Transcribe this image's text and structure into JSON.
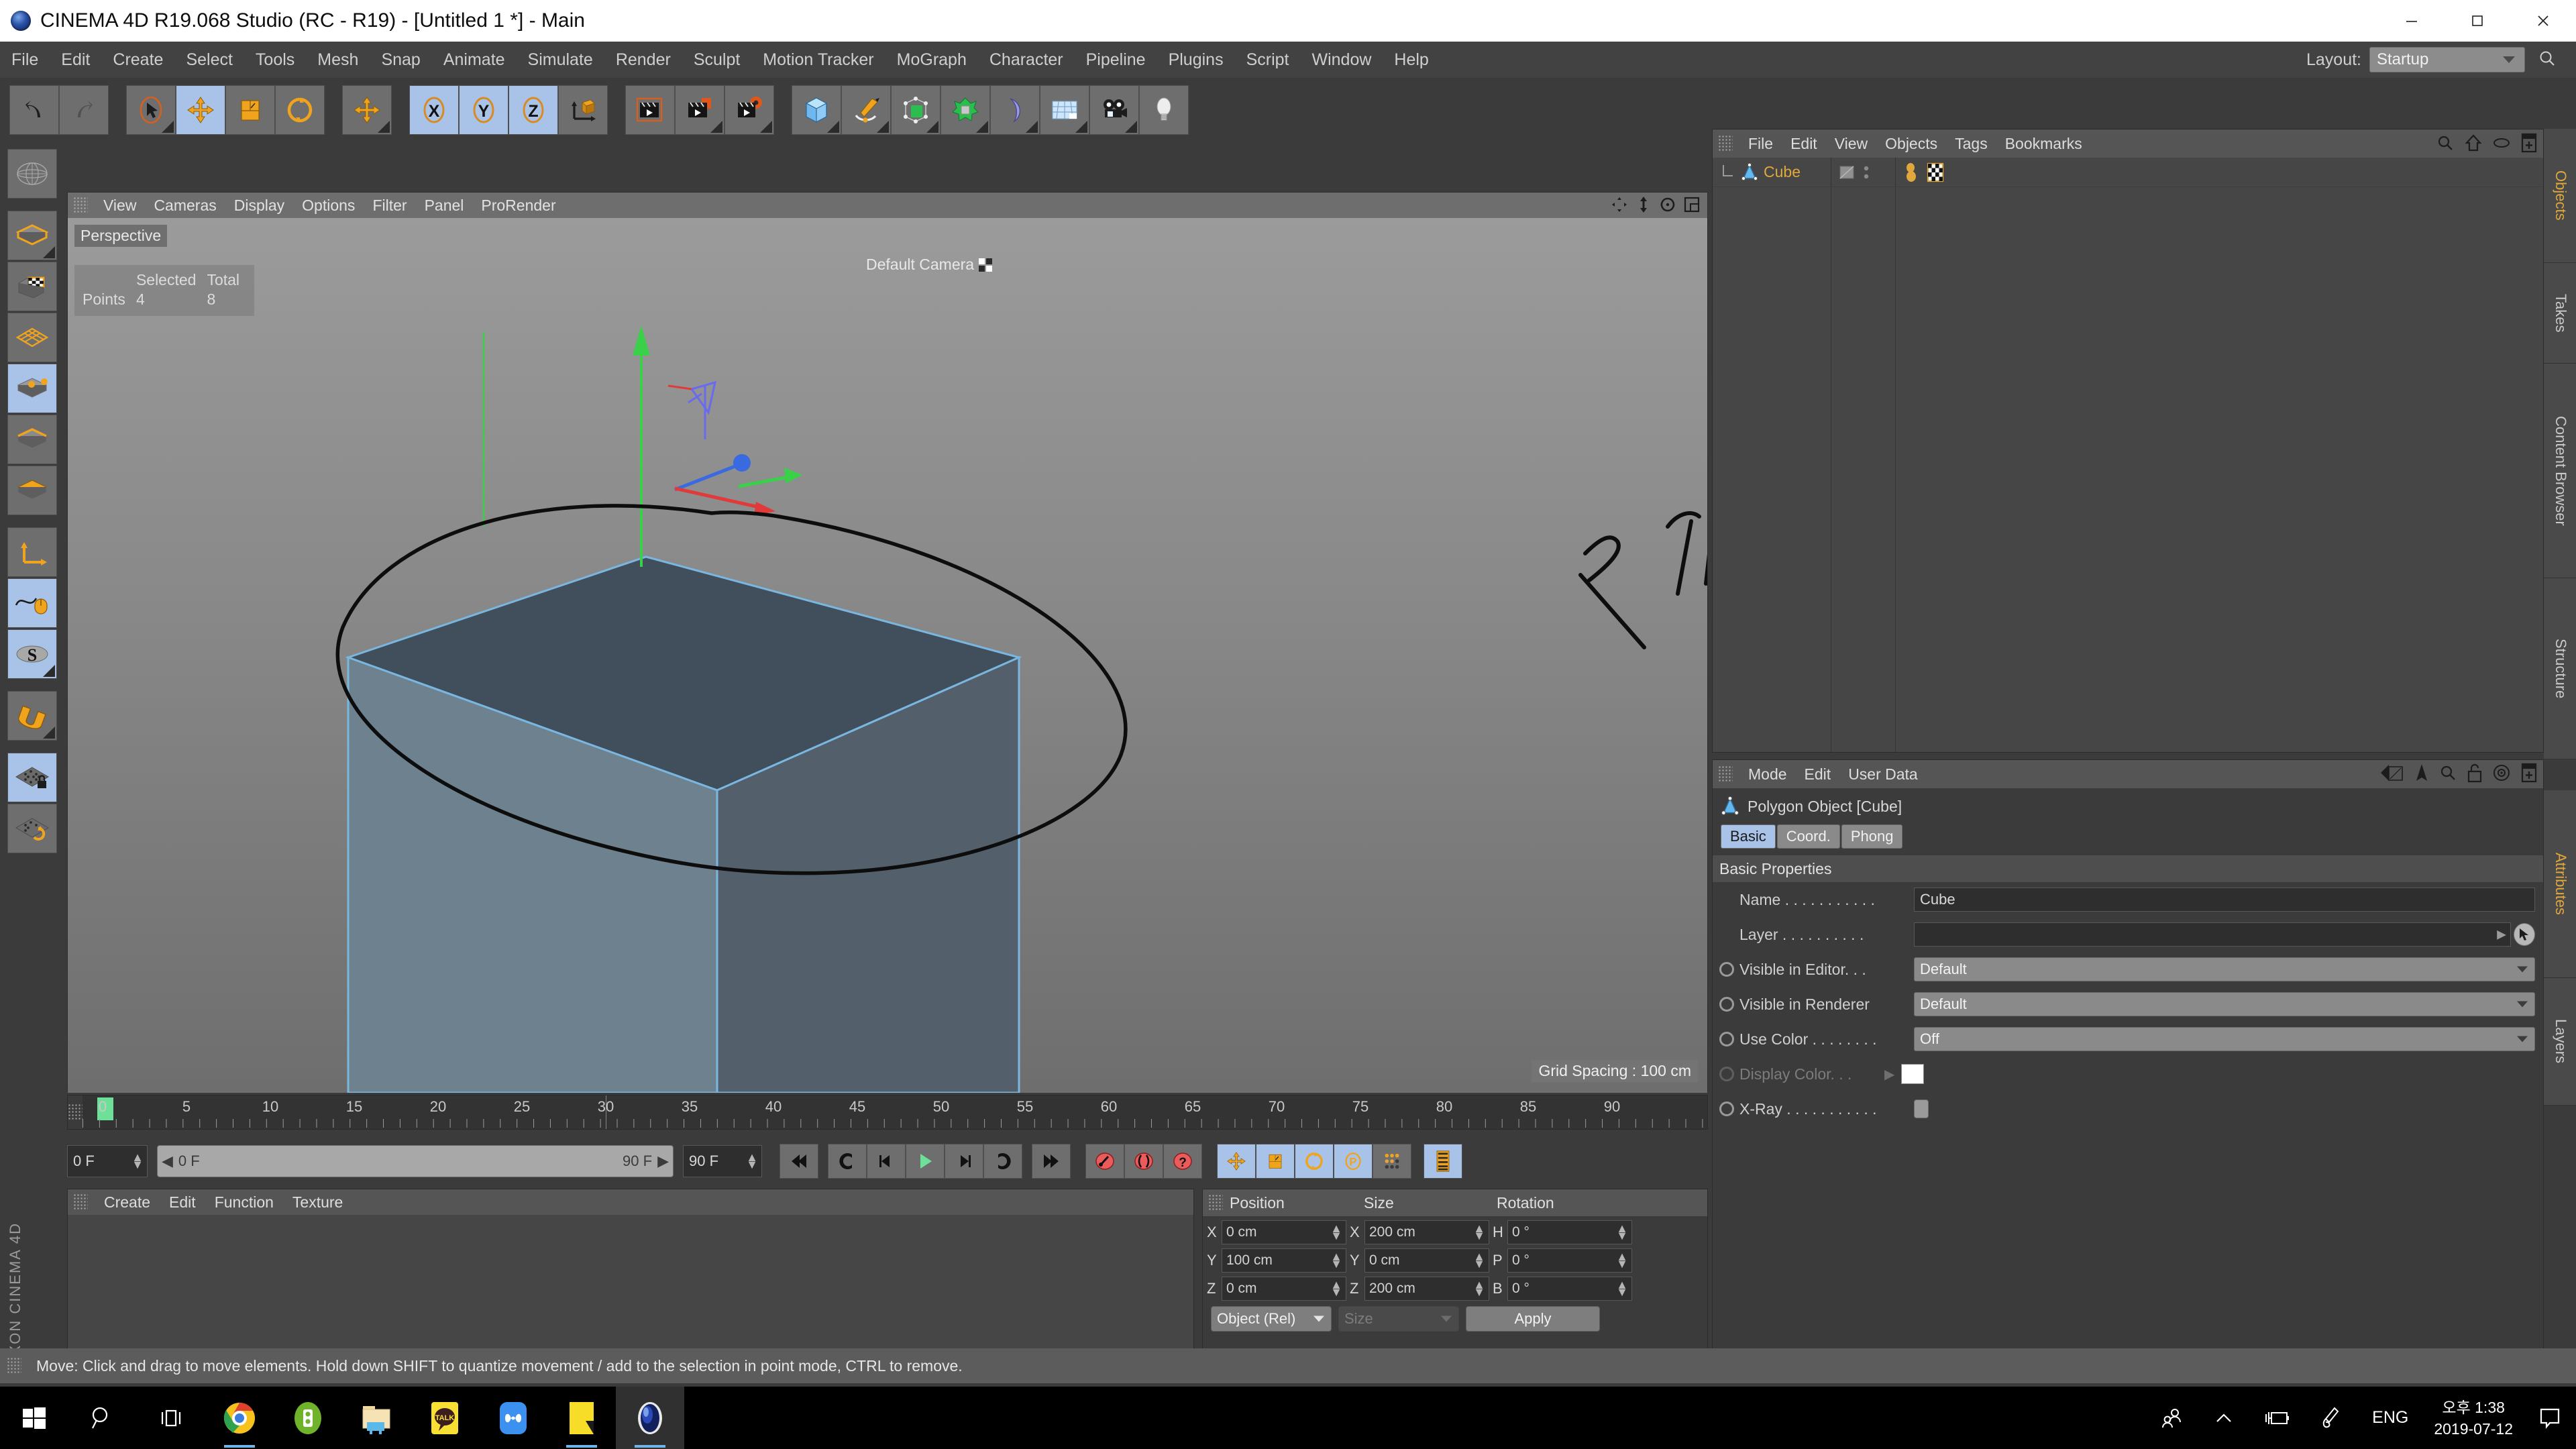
{
  "window": {
    "title": "CINEMA 4D R19.068 Studio (RC - R19) - [Untitled 1 *] - Main",
    "minimize_label": "Minimize",
    "maximize_label": "Maximize",
    "close_label": "Close"
  },
  "menubar": {
    "items": [
      "File",
      "Edit",
      "Create",
      "Select",
      "Tools",
      "Mesh",
      "Snap",
      "Animate",
      "Simulate",
      "Render",
      "Sculpt",
      "Motion Tracker",
      "MoGraph",
      "Character",
      "Pipeline",
      "Plugins",
      "Script",
      "Window",
      "Help"
    ],
    "layout_label": "Layout:",
    "layout_value": "Startup",
    "search_icon": "search-icon"
  },
  "toolbar": {
    "buttons": [
      {
        "name": "undo",
        "icon": "undo-arrow-icon",
        "selected": false
      },
      {
        "name": "redo",
        "icon": "redo-arrow-icon",
        "selected": false
      },
      {
        "name": "live-selection",
        "icon": "cursor-oval-icon",
        "selected": false
      },
      {
        "name": "move",
        "icon": "move-cross-icon",
        "selected": true
      },
      {
        "name": "scale",
        "icon": "scale-box-icon",
        "selected": false
      },
      {
        "name": "rotate",
        "icon": "rotate-circle-icon",
        "selected": false
      },
      {
        "name": "move-dup",
        "icon": "move-cross-icon",
        "selected": false
      },
      {
        "name": "axis-x",
        "icon": "x-axis-icon",
        "selected": true
      },
      {
        "name": "axis-y",
        "icon": "y-axis-icon",
        "selected": true
      },
      {
        "name": "axis-z",
        "icon": "z-axis-icon",
        "selected": true
      },
      {
        "name": "world-object-axis",
        "icon": "world-coordinate-icon",
        "selected": false
      },
      {
        "name": "render-view",
        "icon": "clapper-frame-icon",
        "selected": false
      },
      {
        "name": "render-to-picture-viewer",
        "icon": "clapper-render-icon",
        "selected": false
      },
      {
        "name": "edit-render-settings",
        "icon": "clapper-gear-icon",
        "selected": false
      },
      {
        "name": "add-cube",
        "icon": "cube-primitive-icon",
        "selected": false
      },
      {
        "name": "add-spline",
        "icon": "pen-spline-icon",
        "selected": false
      },
      {
        "name": "add-generator",
        "icon": "generator-nurbs-icon",
        "selected": false
      },
      {
        "name": "add-deformer",
        "icon": "deformer-icon",
        "selected": false
      },
      {
        "name": "add-scene-object",
        "icon": "bend-object-icon",
        "selected": false
      },
      {
        "name": "add-floor-sky",
        "icon": "floor-grid-icon",
        "selected": false
      },
      {
        "name": "add-camera",
        "icon": "camera-icon",
        "selected": false
      },
      {
        "name": "add-light",
        "icon": "light-bulb-icon",
        "selected": false
      }
    ]
  },
  "left_toolbar": {
    "buttons": [
      {
        "name": "make-editable",
        "icon": "wireframe-sphere-icon",
        "selected": false
      },
      {
        "name": "model-mode",
        "icon": "model-cube-icon",
        "selected": false
      },
      {
        "name": "texture-mode",
        "icon": "texture-checker-icon",
        "selected": false
      },
      {
        "name": "mesh-mode",
        "icon": "mesh-grid-icon",
        "selected": false
      },
      {
        "name": "points-mode",
        "icon": "points-cube-icon",
        "selected": true
      },
      {
        "name": "edges-mode",
        "icon": "edges-cube-icon",
        "selected": false
      },
      {
        "name": "polygons-mode",
        "icon": "polygons-cube-icon",
        "selected": false
      },
      {
        "name": "object-axis",
        "icon": "axis-corner-icon",
        "selected": false
      },
      {
        "name": "enable-snap",
        "icon": "mouse-curve-icon",
        "selected": true
      },
      {
        "name": "soft-selection",
        "icon": "s-ellipse-icon",
        "selected": true
      },
      {
        "name": "magnet",
        "icon": "magnet-icon",
        "selected": false
      },
      {
        "name": "workplane-lock",
        "icon": "grid-lock-icon",
        "selected": true
      },
      {
        "name": "workplane-rotate",
        "icon": "grid-rotate-icon",
        "selected": false
      }
    ],
    "brand_line1": "MAXON",
    "brand_line2": "CINEMA 4D"
  },
  "viewport": {
    "menu_items": [
      "View",
      "Cameras",
      "Display",
      "Options",
      "Filter",
      "Panel",
      "ProRender"
    ],
    "perspective_label": "Perspective",
    "camera_label": "Default Camera",
    "grid_spacing": "Grid Spacing : 100 cm",
    "stats": {
      "col_selected": "Selected",
      "col_total": "Total",
      "row_label": "Points",
      "selected": "4",
      "total": "8"
    },
    "corner_icons": [
      "pan-icon",
      "zoom-vertical-icon",
      "rotate-icon",
      "maximize-view-icon"
    ]
  },
  "timeline": {
    "ticks": [
      "0",
      "5",
      "10",
      "15",
      "20",
      "25",
      "30",
      "35",
      "40",
      "45",
      "50",
      "55",
      "60",
      "65",
      "70",
      "75",
      "80",
      "85",
      "90"
    ],
    "current_frame_marker": "0"
  },
  "transport": {
    "current_frame": "0 F",
    "range_start": "0 F",
    "range_end": "90 F",
    "max_frame": "90 F",
    "buttons": [
      {
        "name": "go-to-start",
        "icon": "skip-start-icon",
        "selected": false
      },
      {
        "name": "play-loop-back",
        "icon": "loop-back-icon",
        "selected": false
      },
      {
        "name": "step-back",
        "icon": "step-back-icon",
        "selected": false
      },
      {
        "name": "play-forward",
        "icon": "play-icon",
        "selected": false
      },
      {
        "name": "step-forward",
        "icon": "step-forward-icon",
        "selected": false
      },
      {
        "name": "play-loop-forward",
        "icon": "loop-forward-icon",
        "selected": false
      },
      {
        "name": "go-to-end",
        "icon": "skip-end-icon",
        "selected": false
      },
      {
        "name": "record-keyframe",
        "icon": "record-key-icon",
        "selected": false
      },
      {
        "name": "autokeying",
        "icon": "autokey-icon",
        "selected": false
      },
      {
        "name": "keyframe-selection",
        "icon": "key-question-icon",
        "selected": false
      },
      {
        "name": "position-key",
        "icon": "move-cross-icon",
        "selected": true
      },
      {
        "name": "scale-key",
        "icon": "scale-box-icon",
        "selected": true
      },
      {
        "name": "rotation-key",
        "icon": "rotate-circle-icon",
        "selected": true
      },
      {
        "name": "param-key",
        "icon": "p-circle-icon",
        "selected": true
      },
      {
        "name": "point-level-anim",
        "icon": "pla-dots-icon",
        "selected": false
      },
      {
        "name": "timeline-filmstrip",
        "icon": "filmstrip-icon",
        "selected": true
      }
    ]
  },
  "material_manager": {
    "menu_items": [
      "Create",
      "Edit",
      "Function",
      "Texture"
    ]
  },
  "coordinate_manager": {
    "headers": [
      "Position",
      "Size",
      "Rotation"
    ],
    "rows": [
      {
        "pos_axis": "X",
        "pos_value": "0 cm",
        "size_axis": "X",
        "size_value": "200 cm",
        "rot_axis": "H",
        "rot_value": "0 °"
      },
      {
        "pos_axis": "Y",
        "pos_value": "100 cm",
        "size_axis": "Y",
        "size_value": "0 cm",
        "rot_axis": "P",
        "rot_value": "0 °"
      },
      {
        "pos_axis": "Z",
        "pos_value": "0 cm",
        "size_axis": "Z",
        "size_value": "200 cm",
        "rot_axis": "B",
        "rot_value": "0 °"
      }
    ],
    "mode_dropdown": "Object (Rel)",
    "size_dropdown": "Size",
    "apply_label": "Apply"
  },
  "object_manager": {
    "menu_items": [
      "File",
      "Edit",
      "View",
      "Objects",
      "Tags",
      "Bookmarks"
    ],
    "icons": [
      "search-icon",
      "home-up-icon",
      "ellipse-icon",
      "add-layer-icon"
    ],
    "objects": [
      {
        "name": "Cube",
        "icon": "polygon-object-icon",
        "tags": [
          "texture-tag-icon",
          "checker-tag-icon"
        ]
      }
    ],
    "tab_label": "Objects"
  },
  "attribute_manager": {
    "menu_items": [
      "Mode",
      "Edit",
      "User Data"
    ],
    "icons": [
      "back-arrow-icon",
      "up-arrow-icon",
      "search-icon",
      "lock-icon",
      "target-icon",
      "add-panel-icon"
    ],
    "object_title": "Polygon Object [Cube]",
    "tabs": [
      {
        "label": "Basic",
        "active": true
      },
      {
        "label": "Coord.",
        "active": false
      },
      {
        "label": "Phong",
        "active": false
      }
    ],
    "section_title": "Basic Properties",
    "properties": [
      {
        "label": "Name . . . . . . . . . . .",
        "control": "text",
        "value": "Cube",
        "radio": "none",
        "dim": false
      },
      {
        "label": "Layer  . . . . . . . . . .",
        "control": "layer",
        "value": "",
        "radio": "none",
        "dim": false
      },
      {
        "label": "Visible in Editor. . .",
        "control": "select",
        "value": "Default",
        "radio": "on",
        "dim": false
      },
      {
        "label": "Visible in Renderer",
        "control": "select",
        "value": "Default",
        "radio": "on",
        "dim": false
      },
      {
        "label": "Use Color . . . . . . . .",
        "control": "select",
        "value": "Off",
        "radio": "on",
        "dim": false
      },
      {
        "label": "Display Color. . .",
        "control": "swatch",
        "value": "",
        "radio": "dim",
        "dim": true
      },
      {
        "label": "X-Ray . . . . . . . . . . .",
        "control": "toggle",
        "value": "",
        "radio": "on",
        "dim": false
      }
    ],
    "tab_label_attributes": "Attributes",
    "tab_label_layers": "Layers"
  },
  "right_tabs": {
    "top": [
      "Objects",
      "Takes",
      "Content Browser",
      "Structure"
    ],
    "bottom": [
      "Attributes",
      "Layers"
    ]
  },
  "statusbar": {
    "text": "Move: Click and drag to move elements. Hold down SHIFT to quantize movement / add to the selection in point mode, CTRL to remove."
  },
  "taskbar": {
    "items": [
      {
        "name": "start-button",
        "icon": "windows-logo-icon"
      },
      {
        "name": "search-taskbar",
        "icon": "search-icon"
      },
      {
        "name": "task-view",
        "icon": "task-view-icon"
      },
      {
        "name": "chrome",
        "icon": "chrome-icon",
        "running": true
      },
      {
        "name": "green-app",
        "icon": "green-oval-icon",
        "running": false
      },
      {
        "name": "file-explorer",
        "icon": "folder-icon",
        "running": false
      },
      {
        "name": "kakaotalk",
        "icon": "talk-icon",
        "running": false
      },
      {
        "name": "blue-app",
        "icon": "blue-app-icon",
        "running": false
      },
      {
        "name": "yellow-app",
        "icon": "yellow-note-icon",
        "running": true
      },
      {
        "name": "cinema4d",
        "icon": "c4d-logo-icon",
        "running": true,
        "active": true
      }
    ],
    "tray": [
      {
        "name": "people-icon"
      },
      {
        "name": "show-hidden-icons-chevron"
      },
      {
        "name": "battery-plug-icon"
      },
      {
        "name": "pen-icon"
      }
    ],
    "language": "ENG",
    "time": "오후 1:38",
    "date": "2019-07-12",
    "notification_icon": "notification-icon"
  },
  "colors": {
    "accent_orange": "#e0a83c",
    "selection_blue": "#a9c3e8",
    "panel_bg": "#3b3b3b",
    "cube_face_light": "#8ba0b5",
    "cube_face_dark": "#5e6e7e",
    "axis_red": "#e03a3a",
    "axis_green": "#3ad04a",
    "axis_blue": "#3a6ae0"
  }
}
